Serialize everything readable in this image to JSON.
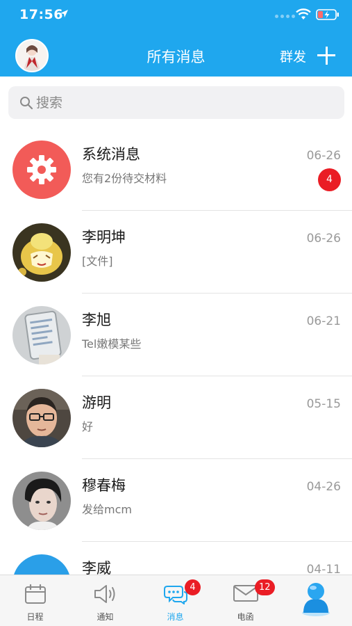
{
  "status_bar": {
    "time": "17:56"
  },
  "header": {
    "title": "所有消息",
    "group_send_label": "群发"
  },
  "search": {
    "placeholder": "搜索"
  },
  "messages": [
    {
      "name": "系统消息",
      "preview": "您有2份待交材料",
      "date": "06-26",
      "badge": "4",
      "avatar": "gear-icon"
    },
    {
      "name": "李明坤",
      "preview": "[文件]",
      "date": "06-26"
    },
    {
      "name": "李旭",
      "preview": "Tel嫩模某些",
      "date": "06-21"
    },
    {
      "name": "游明",
      "preview": "好",
      "date": "05-15"
    },
    {
      "name": "穆春梅",
      "preview": "发给mcm",
      "date": "04-26"
    },
    {
      "name": "李威",
      "preview": "",
      "date": "04-11"
    }
  ],
  "tabbar": {
    "tabs": [
      {
        "label": "日程",
        "icon": "calendar-icon"
      },
      {
        "label": "通知",
        "icon": "speaker-icon"
      },
      {
        "label": "消息",
        "icon": "chat-bubbles-icon",
        "badge": "4",
        "active": true
      },
      {
        "label": "电函",
        "icon": "mail-icon",
        "badge": "12"
      },
      {
        "label": "",
        "icon": "contacts-person-icon"
      }
    ]
  },
  "colors": {
    "brand": "#1fa7ee",
    "badge": "#ea1d25",
    "system_avatar": "#f25b58"
  }
}
